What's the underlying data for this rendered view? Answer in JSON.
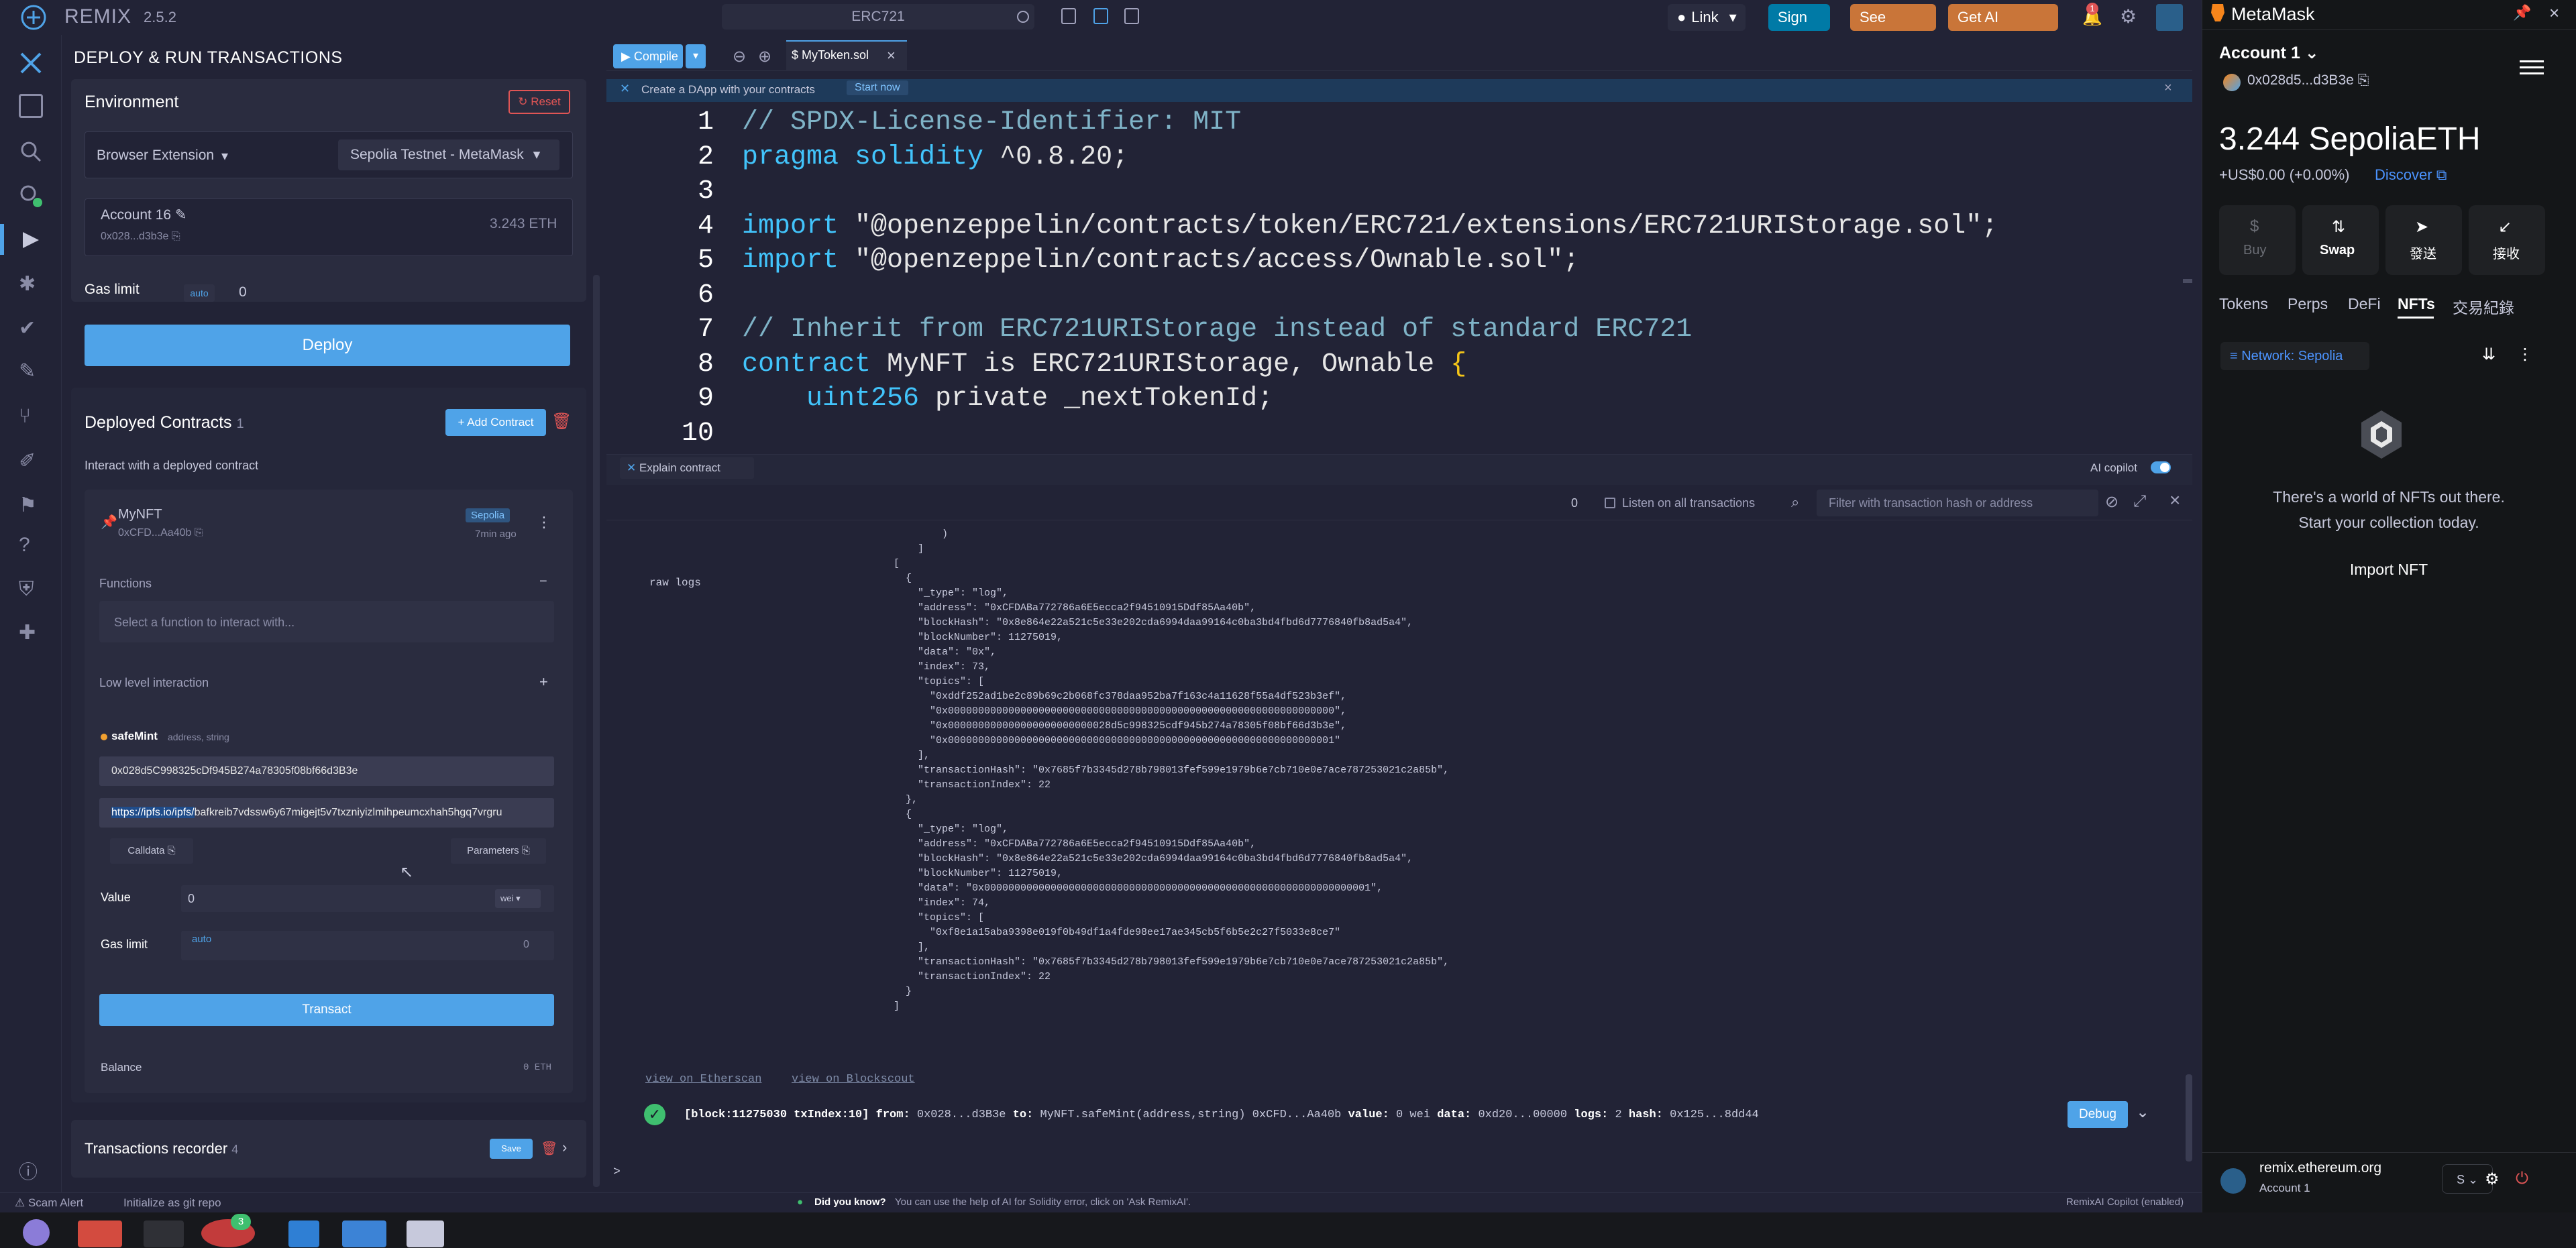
{
  "topbar": {
    "app_name": "REMIX",
    "version": "2.5.2",
    "workspace": "ERC721",
    "link_label": "Link",
    "signin_label": "Sign In",
    "plans_label": "See Plans",
    "credits_label": "Get AI Credits",
    "notification_count": "1"
  },
  "sidepanel": {
    "title": "DEPLOY & RUN TRANSACTIONS",
    "environment_label": "Environment",
    "reset_label": "Reset",
    "env_provider": "Browser Extension",
    "env_network": "Sepolia Testnet - MetaMask",
    "account_name": "Account 16",
    "account_address": "0x028...d3b3e",
    "account_balance": "3.243 ETH",
    "gas_limit_label": "Gas limit",
    "gas_auto": "auto",
    "gas_value": "0",
    "deploy_label": "Deploy",
    "deployed_contracts_label": "Deployed Contracts",
    "deployed_count": "1",
    "add_contract_label": "Add Contract",
    "interact_text": "Interact with a deployed contract",
    "contract_name": "MyNFT",
    "contract_address": "0xCFD...Aa40b",
    "contract_network": "Sepolia",
    "contract_age": "7min ago",
    "functions_label": "Functions",
    "function_select_placeholder": "Select a function to interact with...",
    "low_level_label": "Low level interaction",
    "safemint_label": "safeMint",
    "safemint_params": "address, string",
    "param_address": "0x028d5C998325cDf945B274a78305f08bf66d3B3e",
    "param_uri_link": "https://ipfs.io/ipfs/",
    "param_uri_rest": "bafkreib7vdssw6y67migejt5v7txzniyizlmihpeumcxhah5hgq7vrgru",
    "calldata_label": "Calldata",
    "parameters_label": "Parameters",
    "value_label": "Value",
    "value_amount": "0",
    "value_unit": "wei",
    "gas_limit2_label": "Gas limit",
    "gas2_auto": "auto",
    "gas2_value": "0",
    "transact_label": "Transact",
    "balance_label": "Balance",
    "balance_value": "0 ETH",
    "recorder_label": "Transactions recorder",
    "recorder_count": "4",
    "save_label": "Save"
  },
  "editor": {
    "compile_label": "Compile",
    "tab_name": "MyToken.sol",
    "banner_text": "Create a DApp with your contracts",
    "banner_link": "Start now",
    "lines": [
      {
        "n": "1",
        "parts": [
          {
            "t": "// SPDX-License-Identifier: MIT",
            "c": "c-comment"
          }
        ]
      },
      {
        "n": "2",
        "parts": [
          {
            "t": "pragma solidity ",
            "c": "c-key"
          },
          {
            "t": "^0.8.20;",
            "c": "c-plain"
          }
        ]
      },
      {
        "n": "3",
        "parts": []
      },
      {
        "n": "4",
        "parts": [
          {
            "t": "import ",
            "c": "c-key"
          },
          {
            "t": "\"@openzeppelin/contracts/token/ERC721/extensions/ERC721URIStorage.sol\";",
            "c": "c-str"
          }
        ]
      },
      {
        "n": "5",
        "parts": [
          {
            "t": "import ",
            "c": "c-key"
          },
          {
            "t": "\"@openzeppelin/contracts/access/Ownable.sol\";",
            "c": "c-str"
          }
        ]
      },
      {
        "n": "6",
        "parts": []
      },
      {
        "n": "7",
        "parts": [
          {
            "t": "// Inherit from ERC721URIStorage instead of standard ERC721",
            "c": "c-comment"
          }
        ]
      },
      {
        "n": "8",
        "parts": [
          {
            "t": "contract ",
            "c": "c-key"
          },
          {
            "t": "MyNFT is ERC721URIStorage, Ownable ",
            "c": "c-plain"
          },
          {
            "t": "{",
            "c": "c-yellow"
          }
        ]
      },
      {
        "n": "9",
        "parts": [
          {
            "t": "    uint256 ",
            "c": "c-key"
          },
          {
            "t": "private _nextTokenId;",
            "c": "c-plain"
          }
        ]
      },
      {
        "n": "10",
        "parts": []
      }
    ],
    "explain_label": "Explain contract",
    "ai_copilot_label": "AI copilot"
  },
  "terminal": {
    "tx_count": "0",
    "listen_label": "Listen on all transactions",
    "filter_placeholder": "Filter with transaction hash or address",
    "raw_logs_label": "raw logs",
    "log_lines": [
      "        )",
      "    ] ",
      "[",
      "  {",
      "    \"_type\": \"log\",",
      "    \"address\": \"0xCFDABa772786a6E5ecca2f94510915Ddf85Aa40b\",",
      "    \"blockHash\": \"0x8e864e22a521c5e33e202cda6994daa99164c0ba3bd4fbd6d7776840fb8ad5a4\",",
      "    \"blockNumber\": 11275019,",
      "    \"data\": \"0x\",",
      "    \"index\": 73,",
      "    \"topics\": [",
      "      \"0xddf252ad1be2c89b69c2b068fc378daa952ba7f163c4a11628f55a4df523b3ef\",",
      "      \"0x0000000000000000000000000000000000000000000000000000000000000000\",",
      "      \"0x000000000000000000000000028d5c998325cdf945b274a78305f08bf66d3b3e\",",
      "      \"0x0000000000000000000000000000000000000000000000000000000000000001\"",
      "    ],",
      "    \"transactionHash\": \"0x7685f7b3345d278b798013fef599e1979b6e7cb710e0e7ace787253021c2a85b\",",
      "    \"transactionIndex\": 22",
      "  },",
      "  {",
      "    \"_type\": \"log\",",
      "    \"address\": \"0xCFDABa772786a6E5ecca2f94510915Ddf85Aa40b\",",
      "    \"blockHash\": \"0x8e864e22a521c5e33e202cda6994daa99164c0ba3bd4fbd6d7776840fb8ad5a4\",",
      "    \"blockNumber\": 11275019,",
      "    \"data\": \"0x0000000000000000000000000000000000000000000000000000000000000001\",",
      "    \"index\": 74,",
      "    \"topics\": [",
      "      \"0xf8e1a15aba9398e019f0b49df1a4fde98ee17ae345cb5f6b5e2c27f5033e8ce7\"",
      "    ],",
      "    \"transactionHash\": \"0x7685f7b3345d278b798013fef599e1979b6e7cb710e0e7ace787253021c2a85b\",",
      "    \"transactionIndex\": 22",
      "  }",
      "] "
    ],
    "etherscan_link": "view on Etherscan",
    "blockscout_link": "view on Blockscout",
    "tx_summary_block": "[block:11275030 txIndex:10]",
    "tx_summary_from_label": "from:",
    "tx_summary_from": "0x028...d3B3e",
    "tx_summary_to_label": "to:",
    "tx_summary_to": "MyNFT.safeMint(address,string) 0xCFD...Aa40b",
    "tx_summary_value_label": "value:",
    "tx_summary_value": "0 wei",
    "tx_summary_data_label": "data:",
    "tx_summary_data": "0xd20...00000",
    "tx_summary_logs_label": "logs:",
    "tx_summary_logs": "2",
    "tx_summary_hash_label": "hash:",
    "tx_summary_hash": "0x125...8dd44",
    "debug_label": "Debug",
    "prompt": ">"
  },
  "statusbar": {
    "scam_alert": "Scam Alert",
    "git_init": "Initialize as git repo",
    "did_you_know": "Did you know?",
    "tip": "You can use the help of AI for Solidity error, click on 'Ask RemixAI'.",
    "copilot_status": "RemixAI Copilot (enabled)"
  },
  "metamask": {
    "title": "MetaMask",
    "account_name": "Account 1",
    "account_address": "0x028d5...d3B3e",
    "balance": "3.244 SepoliaETH",
    "fiat": "+US$0.00 (+0.00%)",
    "discover": "Discover",
    "actions": [
      "Buy",
      "Swap",
      "發送",
      "接收"
    ],
    "tabs": [
      "Tokens",
      "Perps",
      "DeFi",
      "NFTs",
      "交易紀錄"
    ],
    "active_tab": "NFTs",
    "network_filter": "Network: Sepolia",
    "empty_title": "There's a world of NFTs out there.",
    "empty_subtitle": "Start your collection today.",
    "import_label": "Import NFT",
    "site_name": "remix.ethereum.org",
    "site_account": "Account 1"
  },
  "colors": {
    "bg": "#222336",
    "card": "#2a2c3f",
    "primary": "#4fa3e8",
    "accent_orange": "#c97539",
    "danger": "#e05555",
    "success": "#3fbf6f"
  }
}
